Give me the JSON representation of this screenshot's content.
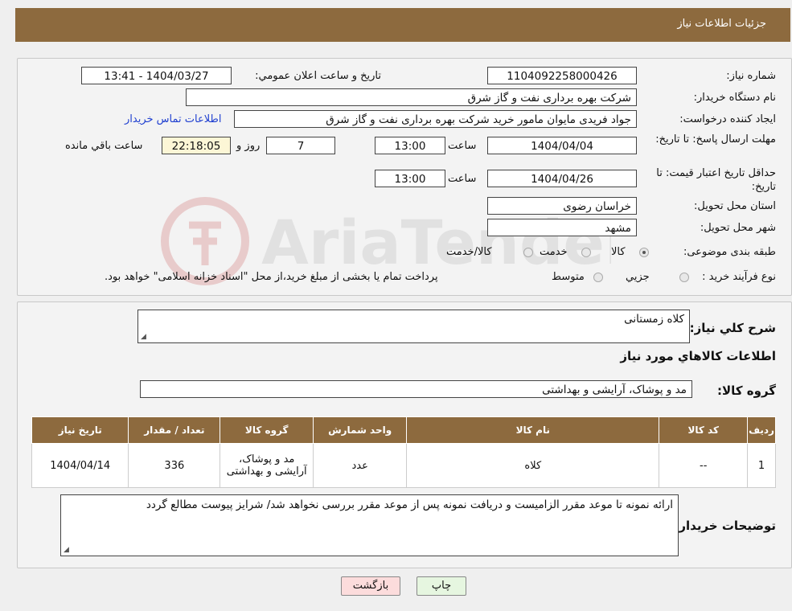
{
  "header": {
    "title": "جزئیات اطلاعات نیاز"
  },
  "watermark": {
    "text": "AriaTender.neT"
  },
  "form": {
    "need_number_label": "شماره نیاز:",
    "need_number": "1104092258000426",
    "announce_label": "تاریخ و ساعت اعلان عمومي:",
    "announce_value": "1404/03/27 - 13:41",
    "buyer_org_label": "نام دستگاه خریدار:",
    "buyer_org": "شرکت بهره برداری نفت و گاز شرق",
    "creator_label": "ایجاد کننده درخواست:",
    "creator": "جواد فریدی مایوان مامور خرید شرکت بهره برداری نفت و گاز شرق",
    "contact_link": "اطلاعات تماس خریدار",
    "deadline_label": "مهلت ارسال پاسخ: تا تاریخ:",
    "deadline_date": "1404/04/04",
    "time_label": "ساعت",
    "deadline_time": "13:00",
    "days_value": "7",
    "days_label": "روز و",
    "remaining_time": "22:18:05",
    "remaining_label": "ساعت باقي مانده",
    "validity_label": "حداقل تاریخ اعتبار قیمت: تا تاریخ:",
    "validity_date": "1404/04/26",
    "validity_time": "13:00",
    "province_label": "استان محل تحویل:",
    "province": "خراسان رضوی",
    "city_label": "شهر محل تحویل:",
    "city": "مشهد",
    "category_label": "طبقه بندی موضوعی:",
    "category_options": [
      "کالا",
      "خدمت",
      "کالا/خدمت"
    ],
    "process_label": "نوع فرآیند خرید :",
    "process_options": [
      "جزیي",
      "متوسط"
    ],
    "process_note": "پرداخت تمام یا بخشی از مبلغ خرید،از محل \"اسناد خزانه اسلامی\" خواهد بود."
  },
  "details": {
    "summary_label": "شرح کلي نیاز:",
    "summary": "کلاه زمستانی",
    "items_title": "اطلاعات کالاهاي مورد نیاز",
    "group_label": "گروه کالا:",
    "group": "مد و پوشاک، آرایشی و بهداشتی",
    "columns": [
      "ردیف",
      "کد کالا",
      "نام کالا",
      "واحد شمارش",
      "گروه کالا",
      "تعداد / مقدار",
      "تاریخ نیاز"
    ],
    "rows": [
      {
        "index": "1",
        "code": "--",
        "name": "کلاه",
        "unit": "عدد",
        "group": "مد و پوشاک، آرایشی و بهداشتی",
        "qty": "336",
        "date": "1404/04/14"
      }
    ],
    "notes_label": "توضیحات خریدار:",
    "notes": "ارائه نمونه تا موعد مقرر الزامیست  و دریافت نمونه پس از موعد مقرر بررسی نخواهد شد/ شرایز پیوست مطالع گردد"
  },
  "buttons": {
    "print": "چاپ",
    "back": "بازگشت"
  },
  "colors": {
    "header": "#8d6a3e",
    "link": "#1f3fd0",
    "time_box": "#fcf6d6"
  }
}
